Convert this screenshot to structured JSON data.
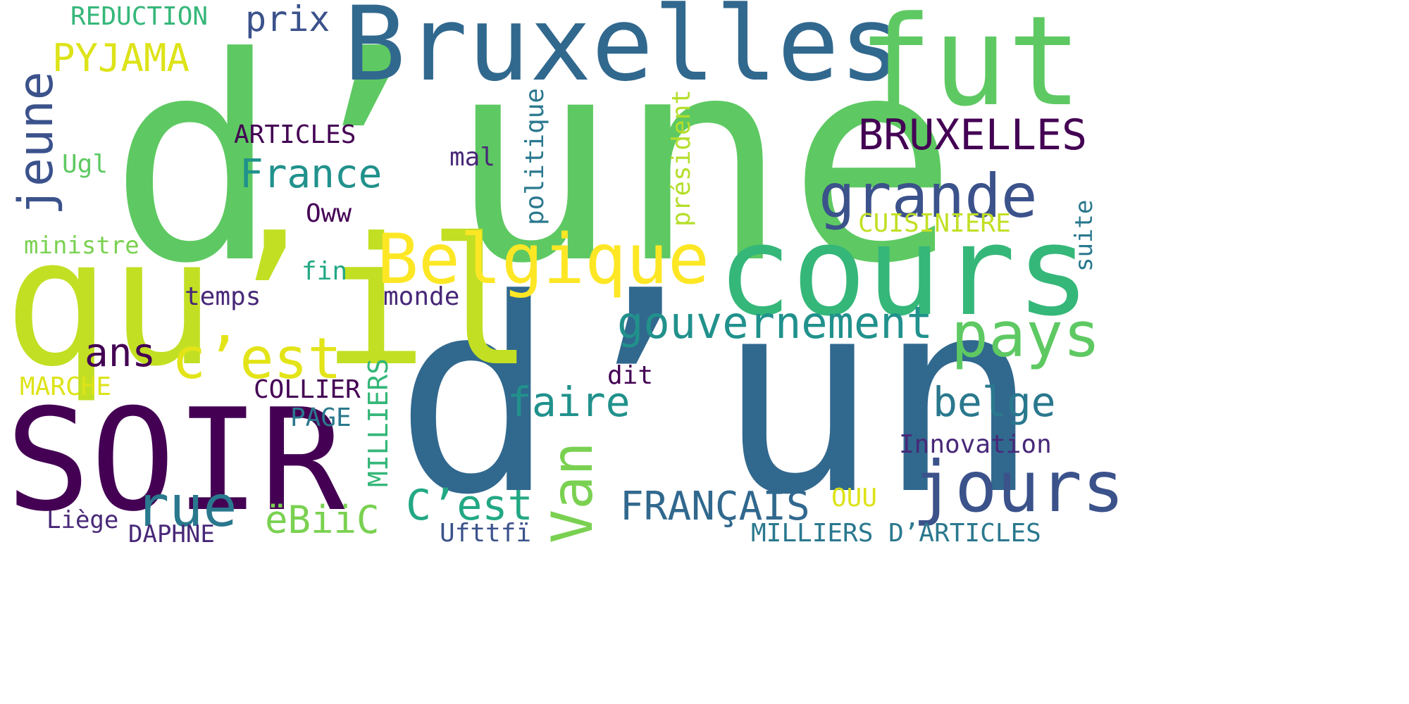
{
  "palette": {
    "dark_purple": "#440154",
    "indigo": "#3b528b",
    "blue": "#31688e",
    "teal": "#21918c",
    "green": "#35b779",
    "light_green": "#5ec962",
    "lime": "#c2df23",
    "yellow": "#fde725"
  },
  "words": [
    {
      "text": "d’une",
      "color": "#5ec962"
    },
    {
      "text": "d’un",
      "color": "#31688e"
    },
    {
      "text": "qu’il",
      "color": "#c2df23"
    },
    {
      "text": "SOIR",
      "color": "#440154"
    },
    {
      "text": "Bruxelles",
      "color": "#31688e"
    },
    {
      "text": "fut",
      "color": "#5ec962"
    },
    {
      "text": "cours",
      "color": "#35b779"
    },
    {
      "text": "Belgique",
      "color": "#fde725"
    },
    {
      "text": "jours",
      "color": "#3b528b"
    },
    {
      "text": "grande",
      "color": "#3b528b"
    },
    {
      "text": "pays",
      "color": "#5ec962"
    },
    {
      "text": "gouvernement",
      "color": "#21918c"
    },
    {
      "text": "BRUXELLES",
      "color": "#440154"
    },
    {
      "text": "c’est",
      "color": "#e3e418"
    },
    {
      "text": "rue",
      "color": "#2a788e"
    },
    {
      "text": "Van",
      "color": "#7ad151"
    },
    {
      "text": "jeune",
      "color": "#3b528b"
    },
    {
      "text": "France",
      "color": "#21918c"
    },
    {
      "text": "faire",
      "color": "#21918c"
    },
    {
      "text": "belge",
      "color": "#2a788e"
    },
    {
      "text": "FRANÇAIS",
      "color": "#31688e"
    },
    {
      "text": "C’est",
      "color": "#22a884"
    },
    {
      "text": "ëBiiC",
      "color": "#7ad151"
    },
    {
      "text": "ans",
      "color": "#440154"
    },
    {
      "text": "PYJAMA",
      "color": "#dde318"
    },
    {
      "text": "prix",
      "color": "#3b528b"
    },
    {
      "text": "REDUCTION",
      "color": "#35b779"
    },
    {
      "text": "Innovation",
      "color": "#482878"
    },
    {
      "text": "MILLIERS D’ARTICLES",
      "color": "#2a788e"
    },
    {
      "text": "MILLIERS",
      "color": "#35b779"
    },
    {
      "text": "ARTICLES",
      "color": "#440154"
    },
    {
      "text": "CUISINIERE",
      "color": "#c2df23"
    },
    {
      "text": "politique",
      "color": "#2a788e"
    },
    {
      "text": "président",
      "color": "#b5de2b"
    },
    {
      "text": "COLLIER",
      "color": "#440154"
    },
    {
      "text": "MARCHE",
      "color": "#dde318"
    },
    {
      "text": "ministre",
      "color": "#7ad151"
    },
    {
      "text": "Oww",
      "color": "#440154"
    },
    {
      "text": "fin",
      "color": "#22a884"
    },
    {
      "text": "temps",
      "color": "#482878"
    },
    {
      "text": "monde",
      "color": "#482878"
    },
    {
      "text": "mal",
      "color": "#482878"
    },
    {
      "text": "dit",
      "color": "#440154"
    },
    {
      "text": "PAGE",
      "color": "#2a788e"
    },
    {
      "text": "Ugl",
      "color": "#5ec962"
    },
    {
      "text": "suite",
      "color": "#2a788e"
    },
    {
      "text": "Liège",
      "color": "#482878"
    },
    {
      "text": "DAPHNE",
      "color": "#482878"
    },
    {
      "text": "Ufttfï",
      "color": "#3b528b"
    },
    {
      "text": "OUU",
      "color": "#dde318"
    }
  ]
}
